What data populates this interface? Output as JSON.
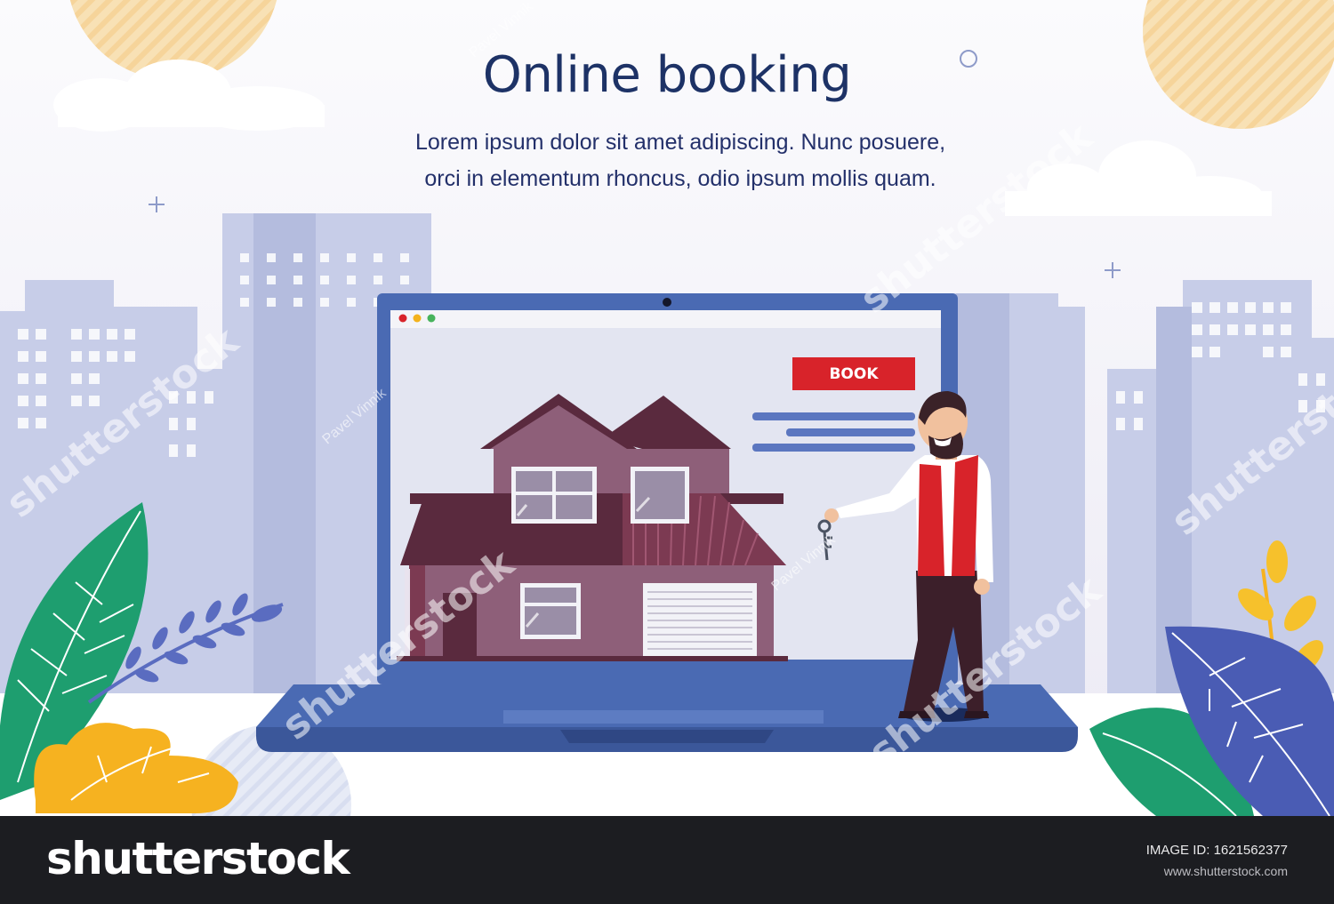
{
  "banner": {
    "title": "Online booking",
    "subtitle_line1": "Lorem ipsum dolor sit amet adipiscing. Nunc posuere,",
    "subtitle_line2": "orci in elementum rhoncus, odio ipsum mollis quam."
  },
  "laptop": {
    "book_button_label": "BOOK"
  },
  "watermark": {
    "brand": "shutterstock",
    "author": "Pavel Vinnik"
  },
  "footer": {
    "brand": "shutterstock",
    "image_id_label": "IMAGE ID:",
    "image_id_value": "1621562377",
    "url": "www.shutterstock.com"
  },
  "colors": {
    "title": "#1d3266",
    "book_button": "#d8232a",
    "laptop": "#4a6ab3",
    "footer_bg": "#1c1d21"
  }
}
